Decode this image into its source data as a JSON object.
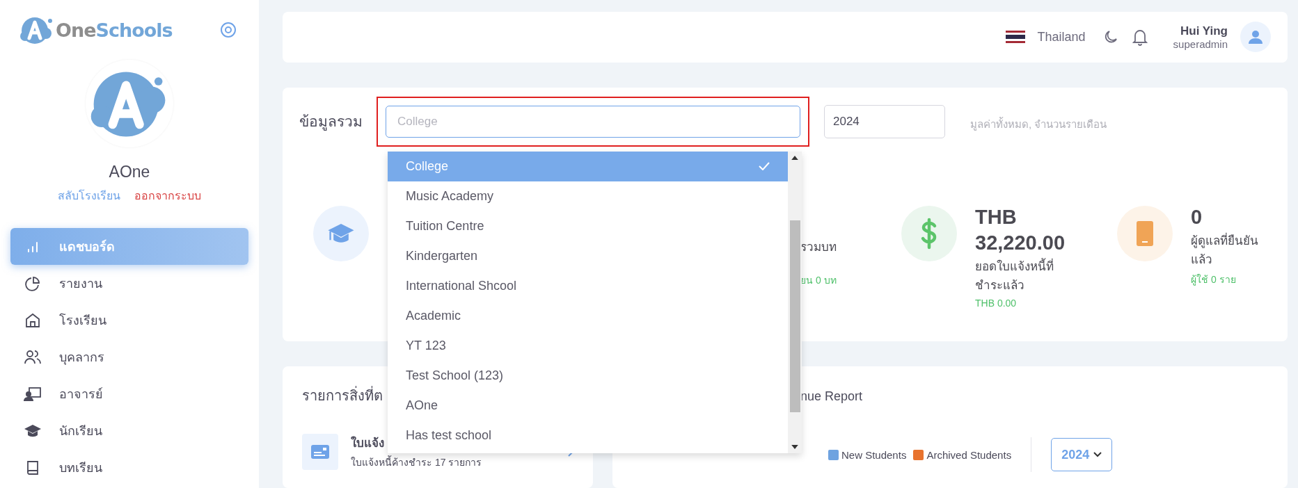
{
  "sidebar": {
    "brand": [
      "One",
      "Schools"
    ],
    "school_name": "AOne",
    "switch_link": "สลับโรงเรียน",
    "logout_link": "ออกจากระบบ",
    "items": [
      {
        "label": "แดชบอร์ด",
        "selected": true
      },
      {
        "label": "รายงาน",
        "selected": false
      },
      {
        "label": "โรงเรียน",
        "selected": false
      },
      {
        "label": "บุคลากร",
        "selected": false
      },
      {
        "label": "อาจารย์",
        "selected": false
      },
      {
        "label": "นักเรียน",
        "selected": false
      },
      {
        "label": "บทเรียน",
        "selected": false
      }
    ]
  },
  "header": {
    "country": "Thailand",
    "user_name": "Hui Ying",
    "user_role": "superadmin"
  },
  "overview": {
    "title": "ข้อมูลรวม",
    "school_select": {
      "placeholder": "College",
      "highlighted": true
    },
    "year_field": {
      "value": "2024"
    },
    "hint": "มูลค่าทั้งหมด, จำนวนรายเดือน",
    "dropdown": [
      {
        "label": "College",
        "selected": true
      },
      {
        "label": "Music Academy",
        "selected": false
      },
      {
        "label": "Tuition Centre",
        "selected": false
      },
      {
        "label": "Kindergarten",
        "selected": false
      },
      {
        "label": "International Shcool",
        "selected": false
      },
      {
        "label": "Academic",
        "selected": false
      },
      {
        "label": "YT 123",
        "selected": false
      },
      {
        "label": "Test School (123)",
        "selected": false
      },
      {
        "label": "AOne",
        "selected": false
      },
      {
        "label": "Has test school",
        "selected": false
      }
    ],
    "stats": [
      {
        "kind": "students"
      },
      {
        "kind": "partial",
        "label": "รวมบท",
        "note": "ยน 0 บท"
      },
      {
        "kind": "money",
        "value_1": "THB",
        "value_2": "32,220.00",
        "label": "ยอดใบแจ้งหนี้ที่ชำระแล้ว",
        "note": "THB 0.00"
      },
      {
        "kind": "guardians",
        "value_1": "0",
        "label": "ผู้ดูแลที่ยืนยันแล้ว",
        "note": "ผู้ใช้ 0 ราย"
      }
    ]
  },
  "todo": {
    "title": "รายการสิ่งที่ต",
    "items": [
      {
        "title": "ใบแจ้ง",
        "subtitle": "ใบแจ้งหนี้ค้างชำระ 17 รายการ"
      }
    ]
  },
  "report": {
    "title": "nue Report",
    "legend": [
      {
        "label": "New Students",
        "color": "#6fa3e0"
      },
      {
        "label": "Archived Students",
        "color": "#e8732e"
      }
    ],
    "year_button": "2024"
  }
}
